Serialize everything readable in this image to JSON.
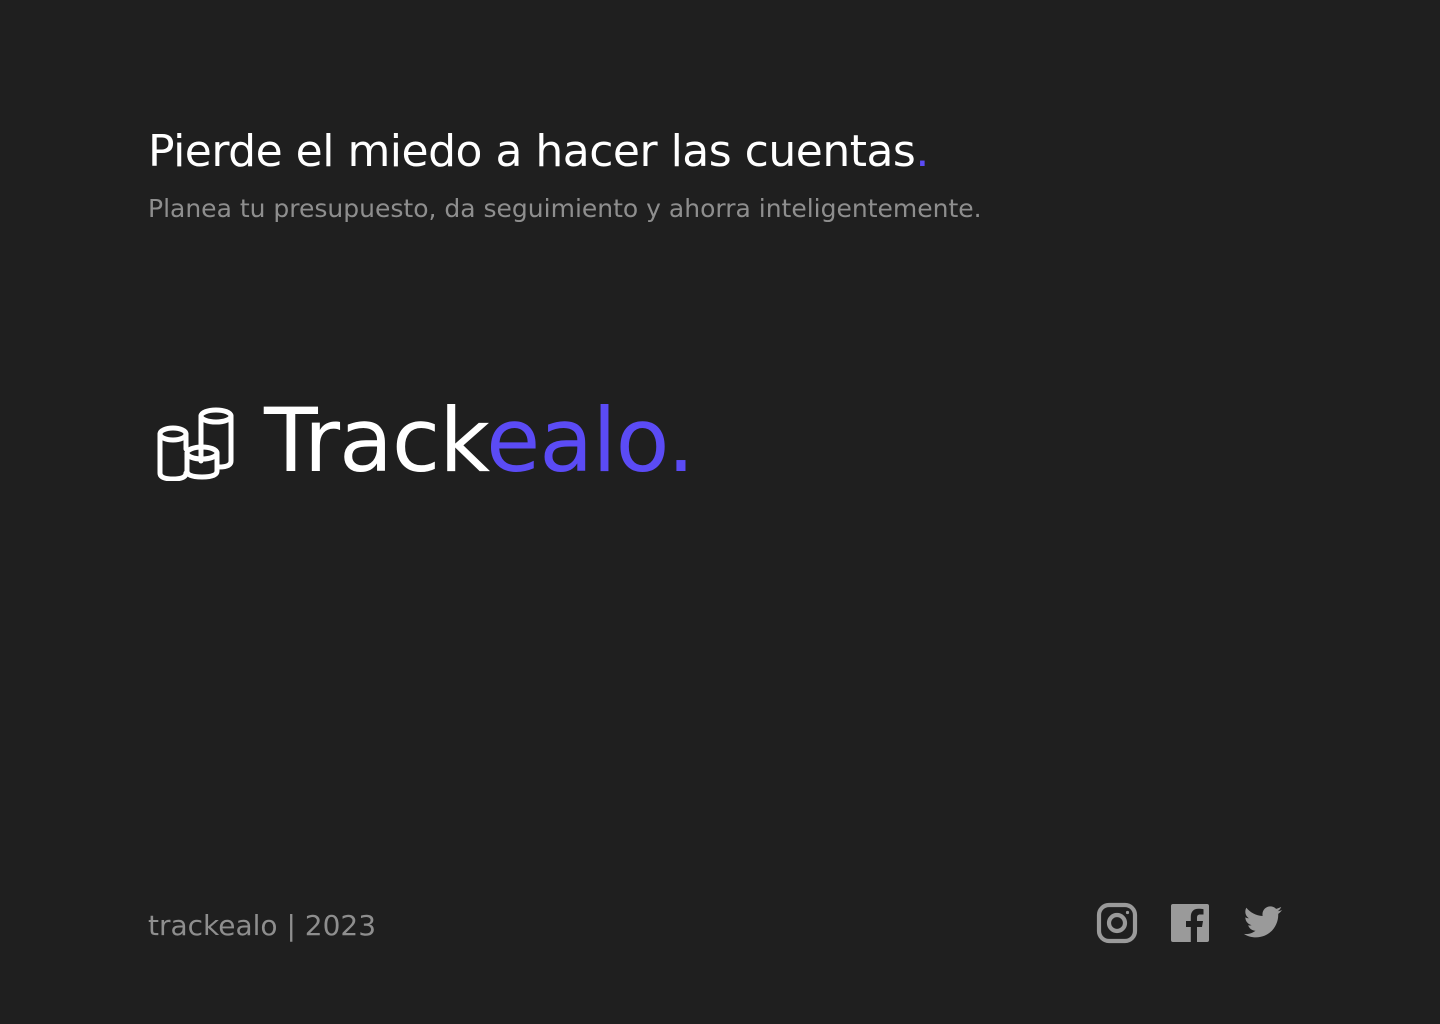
{
  "hero": {
    "headline": "Pierde el miedo a hacer las cuentas",
    "headline_dot": ".",
    "subtitle": "Planea tu presupuesto, da seguimiento y ahorra inteligentemente."
  },
  "brand": {
    "logo_icon": "coins-stack-icon",
    "name_part_white": "Track",
    "name_part_accent": "ealo."
  },
  "footer": {
    "copyright": "trackealo | 2023",
    "social": [
      {
        "icon": "instagram-icon"
      },
      {
        "icon": "facebook-icon"
      },
      {
        "icon": "twitter-icon"
      }
    ]
  },
  "colors": {
    "background": "#1f1f1f",
    "accent": "#5b4bf5",
    "text_primary": "#ffffff",
    "text_muted": "#8e8e8e"
  }
}
